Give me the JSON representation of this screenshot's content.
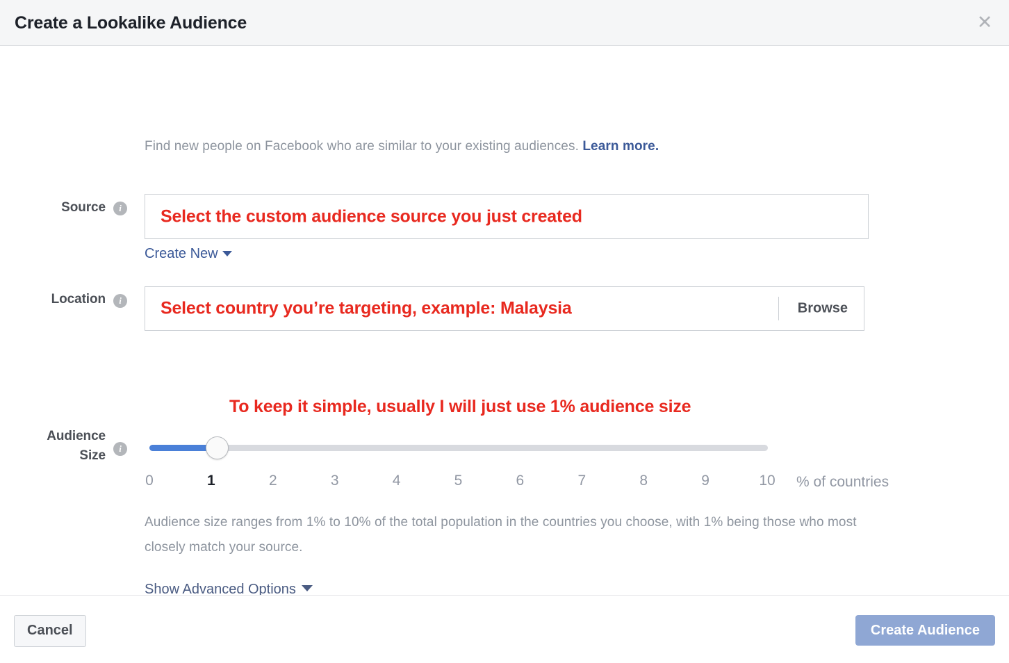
{
  "header": {
    "title": "Create a Lookalike Audience",
    "close_icon": "close-icon"
  },
  "intro": {
    "text": "Find new people on Facebook who are similar to your existing audiences.",
    "link": "Learn more."
  },
  "source": {
    "label": "Source",
    "info_icon": "info-icon",
    "value": "Select the custom audience source you just created",
    "create_new": "Create New"
  },
  "location": {
    "label": "Location",
    "info_icon": "info-icon",
    "value": "Select country you’re targeting, example: Malaysia",
    "browse": "Browse"
  },
  "audience_size": {
    "label_line1": "Audience",
    "label_line2": "Size",
    "info_icon": "info-icon",
    "annotation": "To keep it simple, usually I will just use 1% audience size",
    "selected_value": "1",
    "unit": "% of countries",
    "ticks": [
      "0",
      "1",
      "2",
      "3",
      "4",
      "5",
      "6",
      "7",
      "8",
      "9",
      "10"
    ],
    "helper_text": "Audience size ranges from 1% to 10% of the total population in the countries you choose, with 1% being those who most closely match your source."
  },
  "advanced": {
    "label": "Show Advanced Options"
  },
  "footer": {
    "cancel": "Cancel",
    "create": "Create Audience"
  },
  "colors": {
    "annotation_red": "#e8291f",
    "link_blue": "#3b5998",
    "slider_blue": "#4a80d8",
    "primary_disabled": "#8fa7d4",
    "header_bg": "#f5f6f7"
  }
}
